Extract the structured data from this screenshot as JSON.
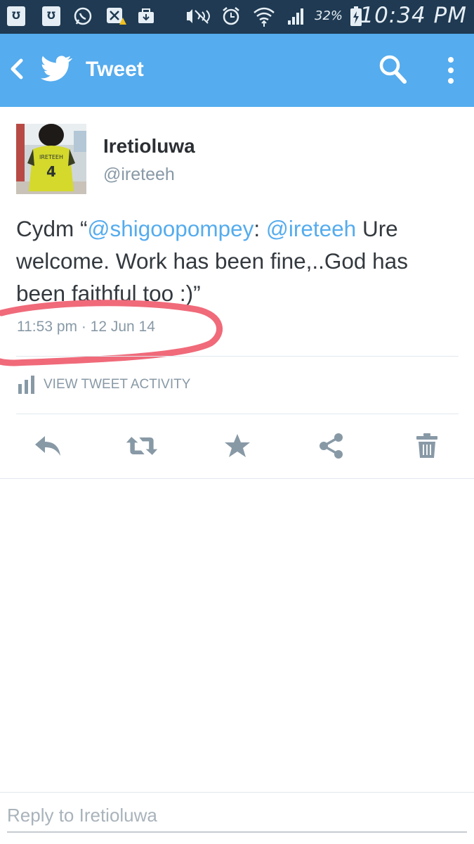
{
  "status_bar": {
    "notification_icons": [
      "Ʊ",
      "Ʊ"
    ],
    "battery_percent": "32%",
    "time": "10:34 PM"
  },
  "app_bar": {
    "title": "Tweet"
  },
  "tweet": {
    "author_name": "Iretioluwa",
    "author_handle": "@ireteeh",
    "text_prefix": "Cydm “",
    "mention_1": "@shigoopompey",
    "text_middle": ": ",
    "mention_2": "@ireteeh",
    "text_suffix": " Ure welcome. Work has been fine,..God has been faithful too :)”",
    "timestamp": "11:53 pm · 12 Jun 14",
    "activity_label": "VIEW TWEET ACTIVITY",
    "avatar_jersey_name": "IRETEEH",
    "avatar_jersey_number": "4"
  },
  "actions": [
    "reply-icon",
    "retweet-icon",
    "favorite-icon",
    "share-icon",
    "delete-icon"
  ],
  "reply": {
    "placeholder": "Reply to Iretioluwa"
  },
  "colors": {
    "brand_blue": "#55acee",
    "status_bar": "#1f3a52",
    "annotation_red": "#f06a7a",
    "muted_text": "#8899a6"
  }
}
